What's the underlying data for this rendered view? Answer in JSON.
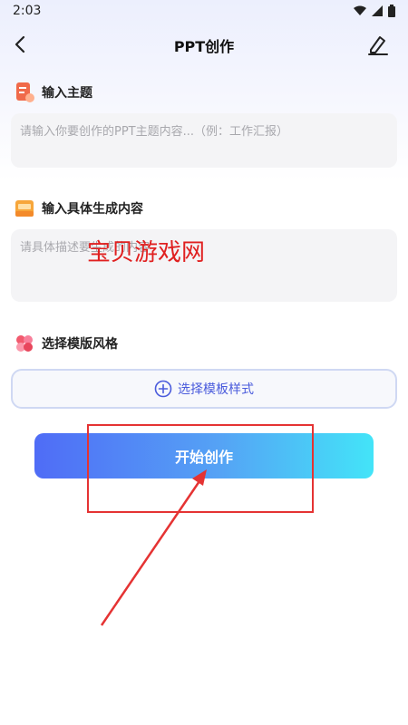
{
  "status_bar": {
    "time": "2:03",
    "icons": [
      "wifi-icon",
      "signal-icon",
      "battery-icon"
    ]
  },
  "header": {
    "title": "PPT创作",
    "back_icon": "back-chevron-icon",
    "edit_icon": "edit-pen-icon"
  },
  "sections": {
    "topic": {
      "label": "输入主题",
      "placeholder": "请输入你要创作的PPT主题内容...（例：工作汇报）"
    },
    "content": {
      "label": "输入具体生成内容",
      "placeholder": "请具体描述要生成的内容"
    },
    "style": {
      "label": "选择模版风格",
      "button_label": "选择模板样式"
    }
  },
  "start_button": {
    "label": "开始创作"
  },
  "overlay": {
    "watermark": "宝贝游戏网"
  },
  "colors": {
    "accent": "#4a5bdc",
    "gradient_start": "#4f6cf6",
    "gradient_end": "#43e4f8",
    "annotation": "#e53333"
  }
}
